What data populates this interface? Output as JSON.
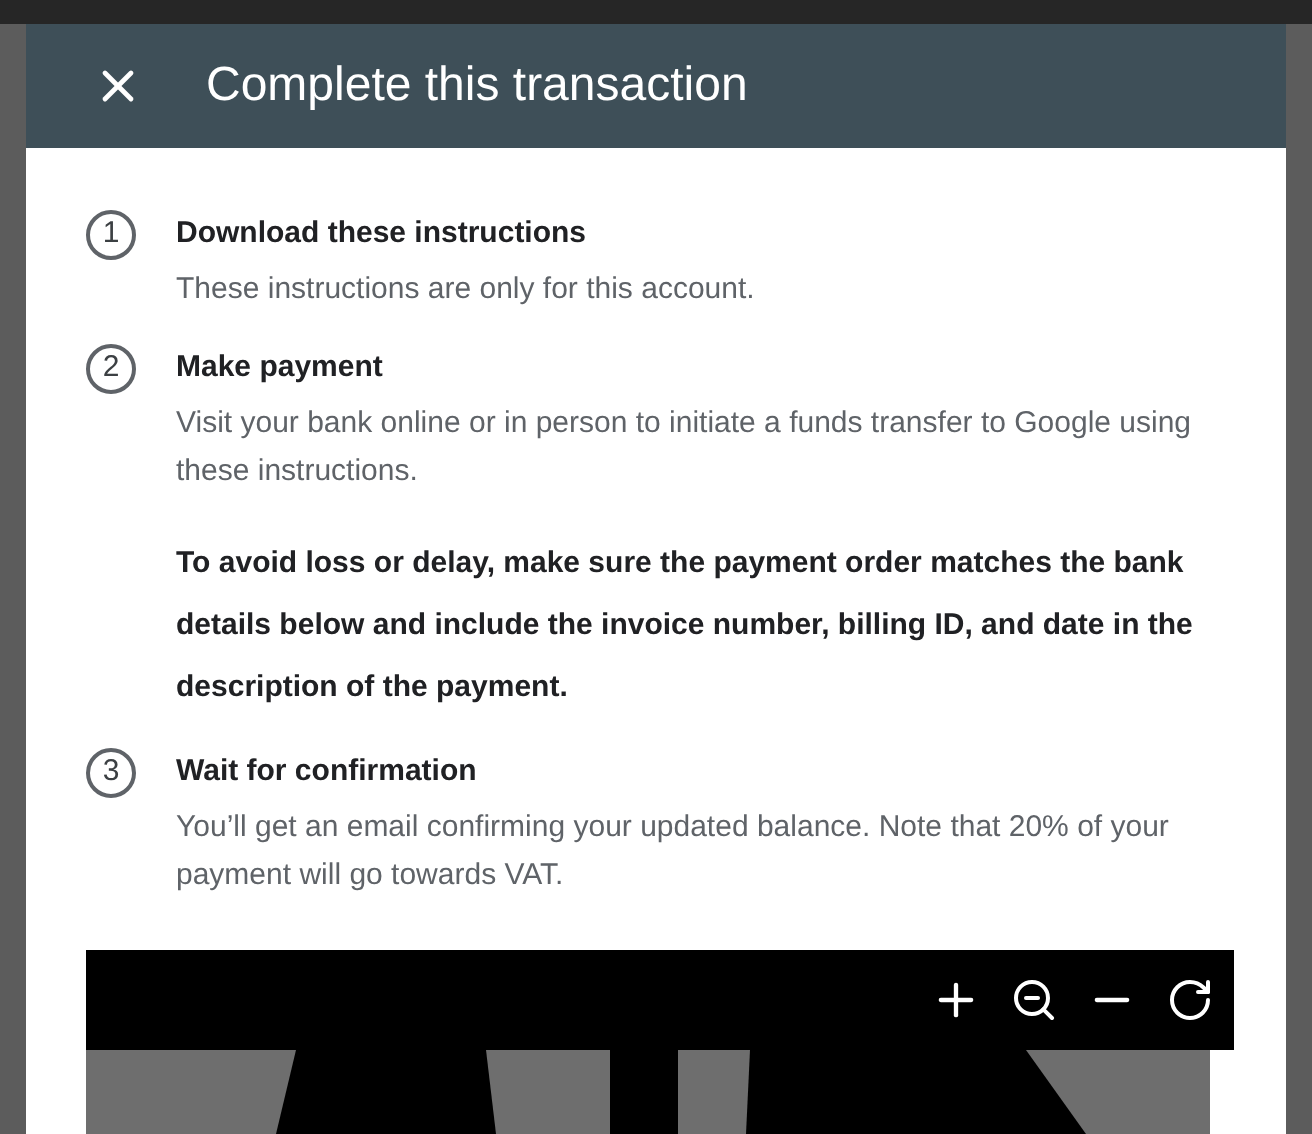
{
  "dialog": {
    "title": "Complete this transaction"
  },
  "steps": [
    {
      "number": "1",
      "title": "Download these instructions",
      "body": "These instructions are only for this account."
    },
    {
      "number": "2",
      "title": "Make payment",
      "body": "Visit your bank online or in person to initiate a funds transfer to Google using these instructions.",
      "note": "To avoid loss or delay, make sure the payment order matches the bank details below and include the invoice number, billing ID, and date in the description of the payment."
    },
    {
      "number": "3",
      "title": "Wait for confirmation",
      "body": "You’ll get an email confirming your updated balance. Note that 20% of your payment will go towards VAT."
    }
  ]
}
